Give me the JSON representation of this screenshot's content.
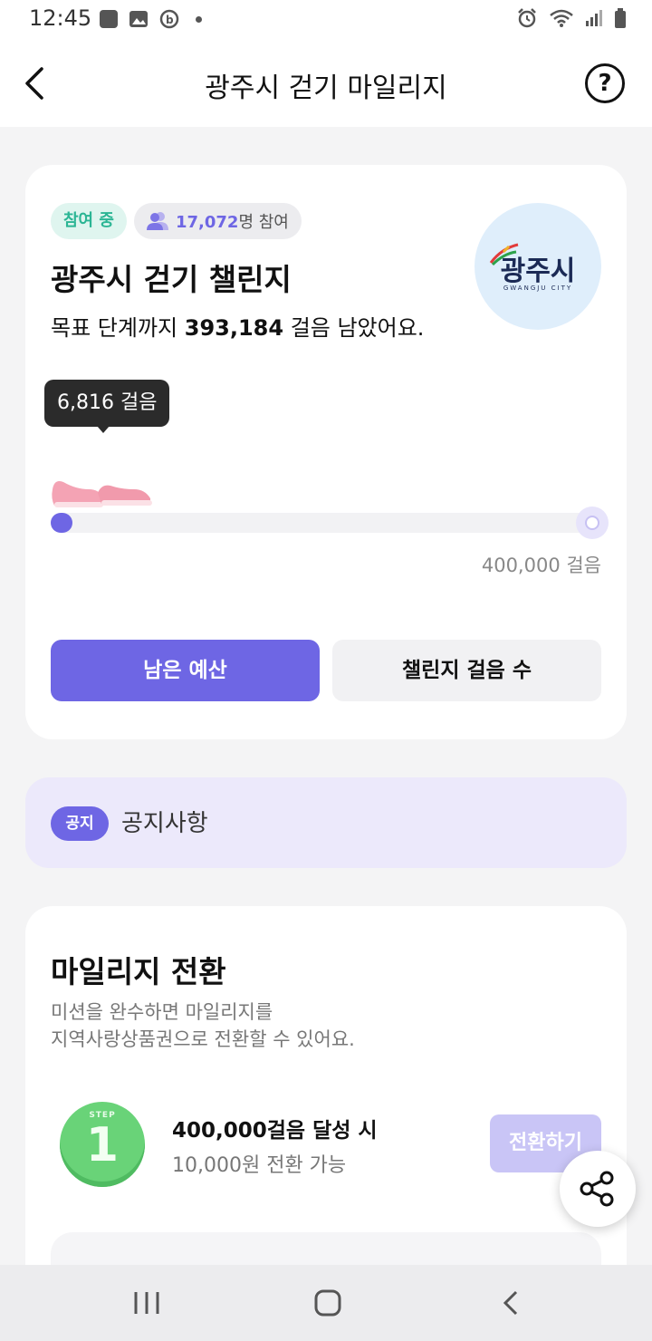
{
  "status_bar": {
    "time": "12:45",
    "left_icons": [
      "notification-61-icon",
      "gallery-icon",
      "b-app-icon",
      "dot-icon"
    ],
    "right_icons": [
      "alarm-icon",
      "wifi-icon",
      "signal-icon",
      "battery-icon"
    ]
  },
  "app_bar": {
    "title": "광주시 걷기 마일리지",
    "back_icon": "chevron-left-icon",
    "help_label": "?"
  },
  "challenge_card": {
    "status_chip": "참여 중",
    "participants_count": "17,072",
    "participants_suffix": "명 참여",
    "title": "광주시 걷기 챌린지",
    "goal_prefix": "목표 단계까지 ",
    "goal_remaining": "393,184",
    "goal_suffix": " 걸음 남았어요.",
    "logo_text": "광주시",
    "logo_sub": "GWANGJU CITY",
    "current_steps_label": "6,816 걸음",
    "goal_steps_label": "400,000 걸음",
    "progress_fraction": 0.017,
    "primary_button": "남은 예산",
    "secondary_button": "챌린지 걸음 수",
    "accent_color": "#6e66e4"
  },
  "notice": {
    "badge": "공지",
    "text": "공지사항"
  },
  "mileage_card": {
    "title": "마일리지 전환",
    "description_line1": "미션을 완수하면 마일리지를",
    "description_line2": "지역사랑상품권으로 전환할 수 있어요.",
    "step": {
      "badge_label": "STEP",
      "badge_number": "1",
      "title": "400,000걸음 달성 시",
      "subtitle": "10,000원 전환 가능",
      "button": "전환하기"
    }
  },
  "share_icon": "share-icon",
  "nav_bar": [
    "recent-apps-icon",
    "home-icon",
    "back-icon"
  ]
}
